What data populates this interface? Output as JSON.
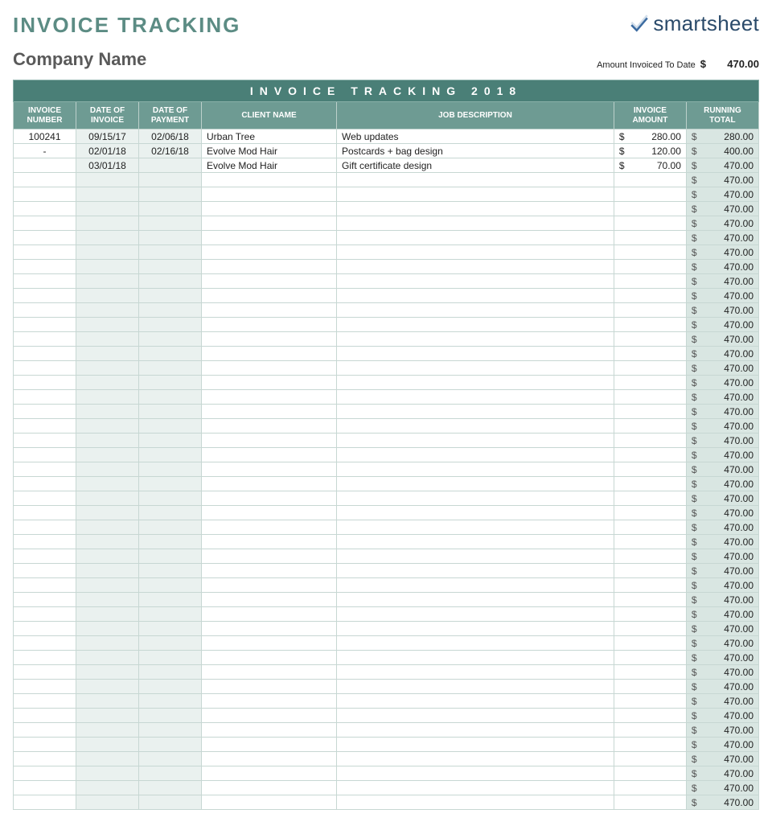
{
  "header": {
    "title": "INVOICE TRACKING",
    "company": "Company Name",
    "logo_brand_prefix": "smart",
    "logo_brand_suffix": "sheet",
    "amount_label": "Amount Invoiced To Date",
    "amount_currency": "$",
    "amount_value": "470.00"
  },
  "band": "INVOICE TRACKING 2018",
  "columns": {
    "c1": "INVOICE NUMBER",
    "c2": "DATE OF INVOICE",
    "c3": "DATE OF PAYMENT",
    "c4": "CLIENT NAME",
    "c5": "JOB DESCRIPTION",
    "c6": "INVOICE AMOUNT",
    "c7": "RUNNING TOTAL"
  },
  "rows": [
    {
      "num": "100241",
      "inv_date": "09/15/17",
      "pay_date": "02/06/18",
      "client": "Urban Tree",
      "job": "Web updates",
      "amount": "280.00",
      "running": "280.00"
    },
    {
      "num": "-",
      "inv_date": "02/01/18",
      "pay_date": "02/16/18",
      "client": "Evolve Mod Hair",
      "job": "Postcards + bag design",
      "amount": "120.00",
      "running": "400.00"
    },
    {
      "num": "",
      "inv_date": "03/01/18",
      "pay_date": "",
      "client": "Evolve Mod Hair",
      "job": "Gift certificate design",
      "amount": "70.00",
      "running": "470.00"
    },
    {
      "running": "470.00"
    },
    {
      "running": "470.00"
    },
    {
      "running": "470.00"
    },
    {
      "running": "470.00"
    },
    {
      "running": "470.00"
    },
    {
      "running": "470.00"
    },
    {
      "running": "470.00"
    },
    {
      "running": "470.00"
    },
    {
      "running": "470.00"
    },
    {
      "running": "470.00"
    },
    {
      "running": "470.00"
    },
    {
      "running": "470.00"
    },
    {
      "running": "470.00"
    },
    {
      "running": "470.00"
    },
    {
      "running": "470.00"
    },
    {
      "running": "470.00"
    },
    {
      "running": "470.00"
    },
    {
      "running": "470.00"
    },
    {
      "running": "470.00"
    },
    {
      "running": "470.00"
    },
    {
      "running": "470.00"
    },
    {
      "running": "470.00"
    },
    {
      "running": "470.00"
    },
    {
      "running": "470.00"
    },
    {
      "running": "470.00"
    },
    {
      "running": "470.00"
    },
    {
      "running": "470.00"
    },
    {
      "running": "470.00"
    },
    {
      "running": "470.00"
    },
    {
      "running": "470.00"
    },
    {
      "running": "470.00"
    },
    {
      "running": "470.00"
    },
    {
      "running": "470.00"
    },
    {
      "running": "470.00"
    },
    {
      "running": "470.00"
    },
    {
      "running": "470.00"
    },
    {
      "running": "470.00"
    },
    {
      "running": "470.00"
    },
    {
      "running": "470.00"
    },
    {
      "running": "470.00"
    },
    {
      "running": "470.00"
    },
    {
      "running": "470.00"
    },
    {
      "running": "470.00"
    },
    {
      "running": "470.00"
    }
  ],
  "currency": "$"
}
